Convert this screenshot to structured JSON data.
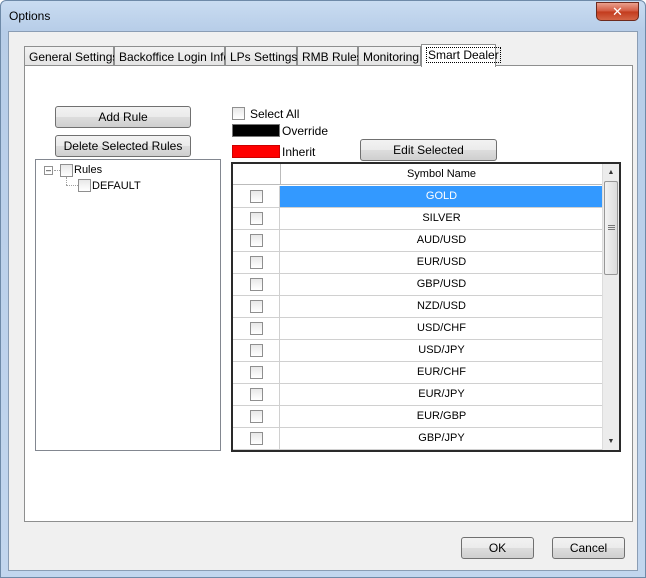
{
  "window": {
    "title": "Options",
    "close_glyph": "✕"
  },
  "tabs": [
    {
      "label": "General Settings"
    },
    {
      "label": "Backoffice Login Info"
    },
    {
      "label": "LPs Settings"
    },
    {
      "label": "RMB Rules"
    },
    {
      "label": "Monitoring"
    },
    {
      "label": "Smart Dealer"
    }
  ],
  "active_tab": "Smart Dealer",
  "buttons": {
    "add_rule": "Add Rule",
    "delete_rules": "Delete Selected Rules",
    "edit_selected": "Edit Selected",
    "ok": "OK",
    "cancel": "Cancel"
  },
  "tree": {
    "root": "Rules",
    "child": "DEFAULT"
  },
  "legend": {
    "select_all": "Select All",
    "override": {
      "label": "Override",
      "color": "#000000"
    },
    "inherit": {
      "label": "Inherit",
      "color": "#ff0000"
    }
  },
  "grid": {
    "header": "Symbol Name",
    "selected_color": "#3399ff",
    "rows": [
      "GOLD",
      "SILVER",
      "AUD/USD",
      "EUR/USD",
      "GBP/USD",
      "NZD/USD",
      "USD/CHF",
      "USD/JPY",
      "EUR/CHF",
      "EUR/JPY",
      "EUR/GBP",
      "GBP/JPY"
    ],
    "selected_row": "GOLD"
  },
  "icons": {
    "tree_expander": "minus-box-icon",
    "scroll_up": "▲",
    "scroll_down": "▼"
  }
}
